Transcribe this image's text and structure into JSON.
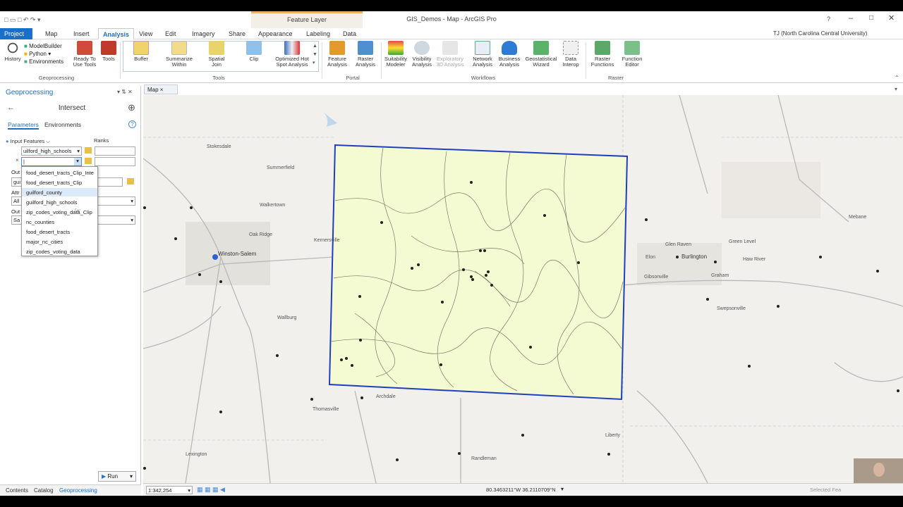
{
  "window": {
    "title": "GIS_Demos - Map - ArcGIS Pro",
    "contextual_tab": "Feature Layer",
    "user": "TJ (North Carolina Central University)",
    "help": "?"
  },
  "tabs": [
    "Project",
    "Map",
    "Insert",
    "Analysis",
    "View",
    "Edit",
    "Imagery",
    "Share",
    "Appearance",
    "Labeling",
    "Data"
  ],
  "ribbon": {
    "geoprocessing_items": [
      "ModelBuilder",
      "Python",
      "Environments"
    ],
    "history": "History",
    "ready_to_use": "Ready To\nUse Tools",
    "tools": "Tools",
    "tools_group": [
      "Buffer",
      "Summarize\nWithin",
      "Spatial\nJoin",
      "Clip",
      "Optimized Hot\nSpot Analysis"
    ],
    "portal_group": [
      "Feature\nAnalysis",
      "Raster\nAnalysis"
    ],
    "workflows_group": [
      "Suitability\nModeler",
      "Visibility\nAnalysis",
      "Exploratory\n3D Analysis",
      "Network\nAnalysis",
      "Business\nAnalysis",
      "Geostatistical\nWizard",
      "Data\nInterop"
    ],
    "raster_group": [
      "Raster\nFunctions",
      "Function\nEditor"
    ],
    "group_labels": {
      "geoprocessing": "Geoprocessing",
      "tools": "Tools",
      "portal": "Portal",
      "workflows": "Workflows",
      "raster": "Raster"
    }
  },
  "geoprocessing_pane": {
    "title": "Geoprocessing",
    "tool_name": "Intersect",
    "tabs": [
      "Parameters",
      "Environments"
    ],
    "input_features_label": "Input Features",
    "ranks_label": "Ranks",
    "input_value": "uilford_high_schools",
    "second_input": "",
    "out_label": "Out",
    "attr_label": "Attr",
    "out2_label": "Out",
    "field_gui": "gui",
    "field_all": "All",
    "field_sa": "Sa",
    "dropdown_items": [
      "food_desert_tracts_Clip_Inte",
      "food_desert_tracts_Clip",
      "guilford_county",
      "guilford_high_schools",
      "zip_codes_voting_data_Clip",
      "nc_counties",
      "food_desert_tracts",
      "major_nc_cities",
      "zip_codes_voting_data"
    ],
    "selected_item": "guilford_county",
    "run": "Run"
  },
  "bottom_tabs": [
    "Contents",
    "Catalog",
    "Geoprocessing"
  ],
  "map": {
    "tab": "Map",
    "scale": "1:342,254",
    "coordinates": "80.3463211°W 36.2110709°N",
    "selected": "Selected Fea",
    "labels": [
      "Winston-Salem",
      "Burlington",
      "Kernersville",
      "Walkertown",
      "Wallburg",
      "Archdale",
      "Thomasville",
      "Lexington",
      "Randleman",
      "Liberty",
      "Graham",
      "Elon",
      "Gibsonville",
      "Swepsonville",
      "Stokesdale",
      "Summerfield",
      "Oak Ridge",
      "Glen Raven",
      "Green Level",
      "Haw River",
      "Mebane"
    ],
    "highlight_color": "#1f3fbf",
    "fill_color": "#f4fbd2"
  }
}
